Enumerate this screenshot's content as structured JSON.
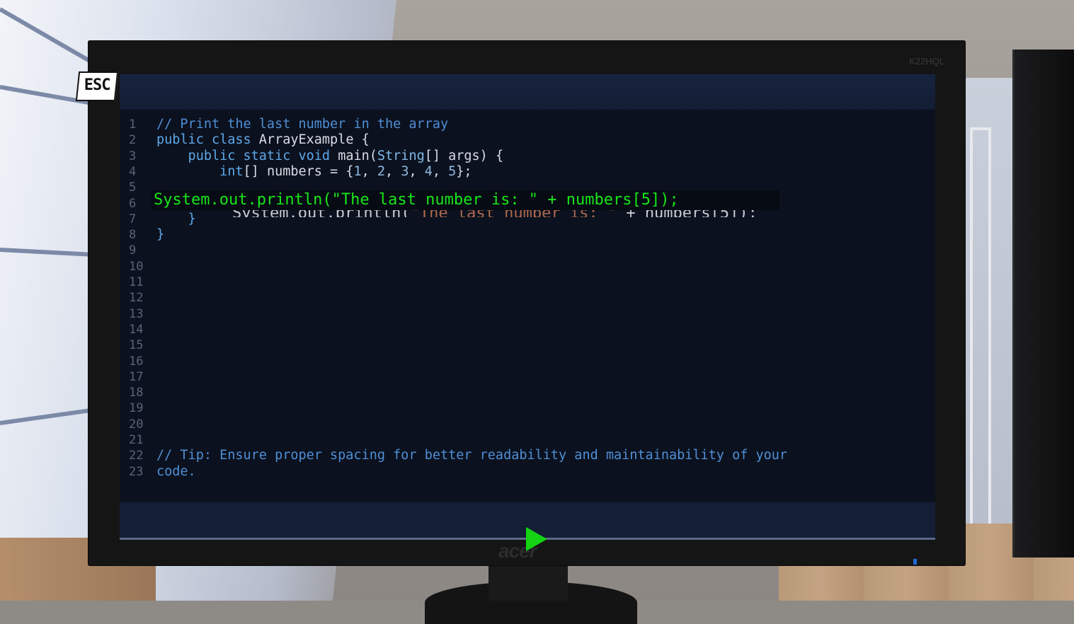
{
  "esc_button": {
    "label": "ESC"
  },
  "monitor": {
    "model": "K22HQL",
    "brand": "acer"
  },
  "editor": {
    "lines": [
      {
        "num": "1",
        "tokens": [
          {
            "t": "// Print the last number in the array",
            "c": "c-comment"
          }
        ]
      },
      {
        "num": "2",
        "tokens": [
          {
            "t": "public class ",
            "c": "c-kw"
          },
          {
            "t": "ArrayExample {",
            "c": "c-plain"
          }
        ]
      },
      {
        "num": "3",
        "tokens": [
          {
            "t": "    public static void ",
            "c": "c-kw"
          },
          {
            "t": "main(",
            "c": "c-plain"
          },
          {
            "t": "String",
            "c": "c-type"
          },
          {
            "t": "[] args) {",
            "c": "c-plain"
          }
        ]
      },
      {
        "num": "4",
        "tokens": [
          {
            "t": "        int",
            "c": "c-kw"
          },
          {
            "t": "[] numbers = {",
            "c": "c-plain"
          },
          {
            "t": "1",
            "c": "c-num"
          },
          {
            "t": ", ",
            "c": "c-plain"
          },
          {
            "t": "2",
            "c": "c-num"
          },
          {
            "t": ", ",
            "c": "c-plain"
          },
          {
            "t": "3",
            "c": "c-num"
          },
          {
            "t": ", ",
            "c": "c-plain"
          },
          {
            "t": "4",
            "c": "c-num"
          },
          {
            "t": ", ",
            "c": "c-plain"
          },
          {
            "t": "5",
            "c": "c-num"
          },
          {
            "t": "};",
            "c": "c-plain"
          }
        ]
      },
      {
        "num": "5",
        "tokens": []
      },
      {
        "num": "6",
        "tokens": []
      },
      {
        "num": "7",
        "tokens": [
          {
            "t": "    }",
            "c": "c-kw"
          }
        ]
      },
      {
        "num": "8",
        "tokens": [
          {
            "t": "}",
            "c": "c-kw"
          }
        ]
      },
      {
        "num": "9",
        "tokens": []
      },
      {
        "num": "10",
        "tokens": []
      },
      {
        "num": "11",
        "tokens": []
      },
      {
        "num": "12",
        "tokens": []
      },
      {
        "num": "13",
        "tokens": []
      },
      {
        "num": "14",
        "tokens": []
      },
      {
        "num": "15",
        "tokens": []
      },
      {
        "num": "16",
        "tokens": []
      },
      {
        "num": "17",
        "tokens": []
      },
      {
        "num": "18",
        "tokens": []
      },
      {
        "num": "19",
        "tokens": []
      },
      {
        "num": "20",
        "tokens": []
      },
      {
        "num": "21",
        "tokens": []
      },
      {
        "num": "22",
        "tokens": [
          {
            "t": "// Tip: Ensure proper spacing for better readability and maintainability of your",
            "c": "c-comment"
          }
        ]
      },
      {
        "num": "23",
        "tokens": [
          {
            "t": "code.",
            "c": "c-comment"
          }
        ]
      }
    ],
    "ghost_line": {
      "plain1": "System.out.println(",
      "str": "\"The last number is: \"",
      "plain2": " + numbers[5]);"
    },
    "dragged_line": "System.out.println(\"The last number is: \" + numbers[5]);"
  },
  "run_button": {
    "icon": "play-icon"
  }
}
